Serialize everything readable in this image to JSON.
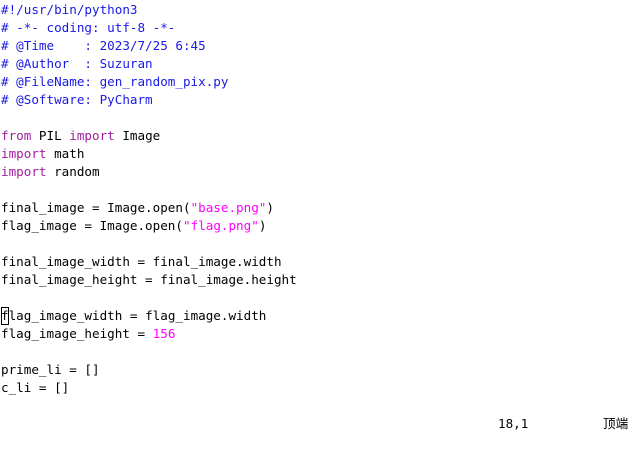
{
  "editor": {
    "lines": [
      [
        {
          "text": "#!/usr/bin/python3",
          "kind": "comment"
        }
      ],
      [
        {
          "text": "# -*- coding: utf-8 -*-",
          "kind": "comment"
        }
      ],
      [
        {
          "text": "# @Time    : 2023/7/25 6:45",
          "kind": "comment"
        }
      ],
      [
        {
          "text": "# @Author  : Suzuran",
          "kind": "comment"
        }
      ],
      [
        {
          "text": "# @FileName: gen_random_pix.py",
          "kind": "comment"
        }
      ],
      [
        {
          "text": "# @Software: PyCharm",
          "kind": "comment"
        }
      ],
      [],
      [
        {
          "text": "from",
          "kind": "keyword"
        },
        {
          "text": " PIL ",
          "kind": "text"
        },
        {
          "text": "import",
          "kind": "keyword"
        },
        {
          "text": " Image",
          "kind": "text"
        }
      ],
      [
        {
          "text": "import",
          "kind": "keyword"
        },
        {
          "text": " math",
          "kind": "text"
        }
      ],
      [
        {
          "text": "import",
          "kind": "keyword"
        },
        {
          "text": " random",
          "kind": "text"
        }
      ],
      [],
      [
        {
          "text": "final_image = Image.open(",
          "kind": "text"
        },
        {
          "text": "\"base.png\"",
          "kind": "string"
        },
        {
          "text": ")",
          "kind": "text"
        }
      ],
      [
        {
          "text": "flag_image = Image.open(",
          "kind": "text"
        },
        {
          "text": "\"flag.png\"",
          "kind": "string"
        },
        {
          "text": ")",
          "kind": "text"
        }
      ],
      [],
      [
        {
          "text": "final_image_width = final_image.width",
          "kind": "text"
        }
      ],
      [
        {
          "text": "final_image_height = final_image.height",
          "kind": "text"
        }
      ],
      [],
      [
        {
          "text": "f",
          "kind": "cursor"
        },
        {
          "text": "lag_image_width = flag_image.width",
          "kind": "text"
        }
      ],
      [
        {
          "text": "flag_image_height = ",
          "kind": "text"
        },
        {
          "text": "156",
          "kind": "number"
        }
      ],
      [],
      [
        {
          "text": "prime_li = []",
          "kind": "text"
        }
      ],
      [
        {
          "text": "c_li = []",
          "kind": "text"
        }
      ]
    ]
  },
  "status": {
    "position": "18,1",
    "scroll": "顶端"
  },
  "colors": {
    "comment": "#1a1ae6",
    "keyword": "#a020a0",
    "string": "#ff00ff",
    "number": "#ff00ff",
    "text": "#000000",
    "background": "#ffffff"
  }
}
